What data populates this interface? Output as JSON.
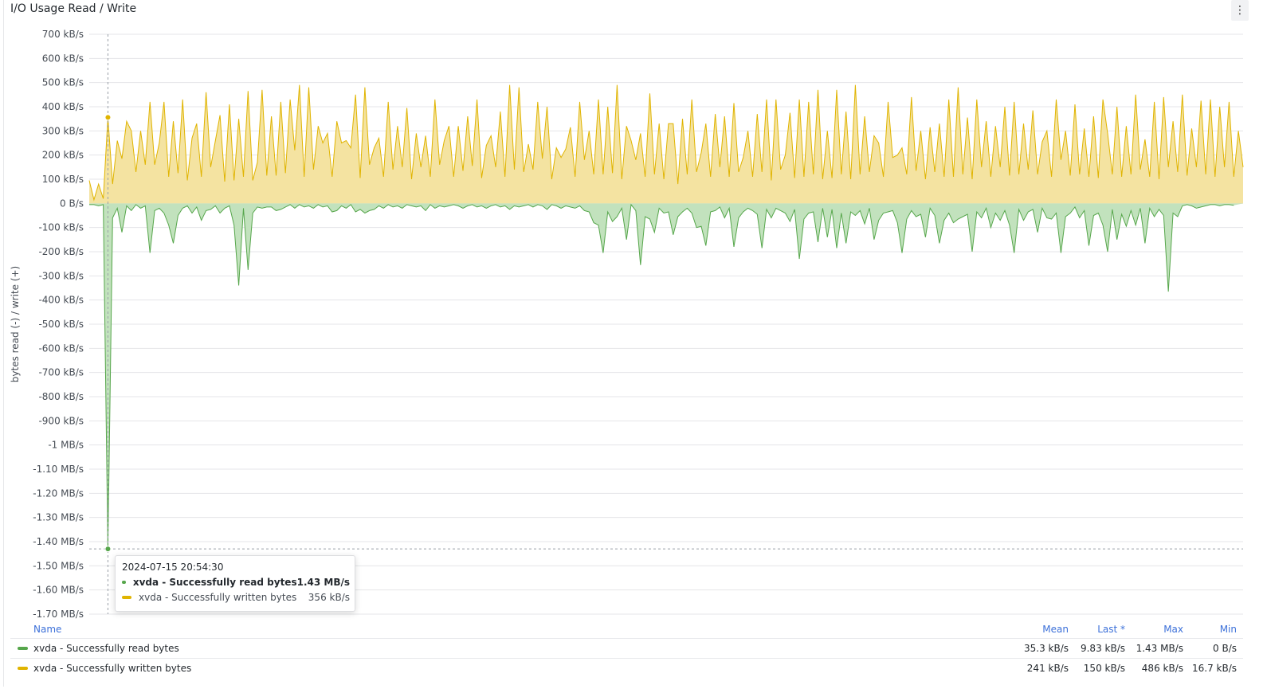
{
  "panel": {
    "title": "I/O Usage Read / Write",
    "menu_icon": "kebab-menu-icon",
    "menu_glyph": "⋮"
  },
  "colors": {
    "read": "#56a64b",
    "write": "#e0b400",
    "read_fill": "#c2e2bd",
    "write_fill": "#f4e3a1",
    "grid": "#e4e5e8"
  },
  "chart_data": {
    "type": "area",
    "ylabel": "bytes read (-) / write (+)",
    "y_unit": "kB/s",
    "ylim": [
      -1700,
      700
    ],
    "yticks": [
      700,
      600,
      500,
      400,
      300,
      200,
      100,
      0,
      -100,
      -200,
      -300,
      -400,
      -500,
      -600,
      -700,
      -800,
      -900,
      -1000,
      -1100,
      -1200,
      -1300,
      -1400,
      -1500,
      -1600,
      -1700
    ],
    "ytick_labels": [
      "700 kB/s",
      "600 kB/s",
      "500 kB/s",
      "400 kB/s",
      "300 kB/s",
      "200 kB/s",
      "100 kB/s",
      "0 B/s",
      "-100 kB/s",
      "-200 kB/s",
      "-300 kB/s",
      "-400 kB/s",
      "-500 kB/s",
      "-600 kB/s",
      "-700 kB/s",
      "-800 kB/s",
      "-900 kB/s",
      "-1 MB/s",
      "-1.10 MB/s",
      "-1.20 MB/s",
      "-1.30 MB/s",
      "-1.40 MB/s",
      "-1.50 MB/s",
      "-1.60 MB/s",
      "-1.70 MB/s"
    ],
    "grid": true,
    "series": [
      {
        "name": "xvda - Successfully written bytes",
        "sign": "+",
        "values": [
          95,
          15,
          80,
          20,
          356,
          80,
          260,
          185,
          340,
          300,
          130,
          300,
          160,
          420,
          160,
          250,
          420,
          110,
          340,
          125,
          430,
          95,
          270,
          330,
          110,
          460,
          150,
          260,
          365,
          90,
          410,
          95,
          350,
          110,
          465,
          95,
          170,
          470,
          115,
          360,
          115,
          420,
          125,
          430,
          220,
          490,
          110,
          480,
          140,
          320,
          250,
          290,
          110,
          340,
          250,
          260,
          230,
          450,
          105,
          480,
          160,
          230,
          270,
          110,
          420,
          140,
          320,
          150,
          395,
          100,
          290,
          150,
          280,
          110,
          430,
          160,
          260,
          320,
          110,
          320,
          135,
          360,
          155,
          430,
          105,
          240,
          280,
          150,
          380,
          110,
          490,
          140,
          480,
          130,
          245,
          140,
          420,
          185,
          400,
          100,
          230,
          190,
          225,
          315,
          110,
          420,
          180,
          300,
          120,
          430,
          120,
          400,
          125,
          490,
          100,
          320,
          260,
          180,
          290,
          110,
          455,
          120,
          330,
          100,
          330,
          330,
          80,
          350,
          120,
          430,
          130,
          210,
          330,
          110,
          370,
          150,
          360,
          110,
          415,
          130,
          190,
          300,
          110,
          370,
          130,
          430,
          95,
          430,
          140,
          200,
          375,
          105,
          430,
          110,
          420,
          120,
          470,
          100,
          300,
          105,
          470,
          120,
          380,
          100,
          490,
          120,
          360,
          130,
          280,
          250,
          110,
          420,
          190,
          200,
          230,
          120,
          440,
          135,
          300,
          100,
          315,
          130,
          330,
          110,
          430,
          110,
          480,
          120,
          355,
          100,
          430,
          150,
          340,
          110,
          320,
          150,
          400,
          115,
          420,
          120,
          330,
          140,
          385,
          120,
          255,
          300,
          110,
          430,
          180,
          300,
          115,
          410,
          120,
          310,
          110,
          360,
          105,
          430,
          290,
          120,
          400,
          110,
          320,
          120,
          450,
          140,
          265,
          110,
          420,
          100,
          440,
          150,
          340,
          130,
          450,
          115,
          310,
          150,
          425,
          120,
          430,
          110,
          400,
          150,
          420,
          110,
          300,
          150
        ]
      },
      {
        "name": "xvda - Successfully read bytes",
        "sign": "-",
        "values": [
          5,
          5,
          10,
          5,
          1430,
          60,
          20,
          120,
          10,
          30,
          5,
          20,
          10,
          205,
          30,
          20,
          40,
          90,
          165,
          50,
          20,
          10,
          40,
          15,
          70,
          30,
          25,
          10,
          40,
          20,
          10,
          90,
          340,
          20,
          275,
          40,
          15,
          20,
          15,
          15,
          30,
          25,
          15,
          5,
          20,
          5,
          15,
          10,
          20,
          5,
          15,
          10,
          35,
          30,
          10,
          20,
          5,
          35,
          25,
          40,
          30,
          25,
          10,
          20,
          5,
          15,
          10,
          20,
          5,
          10,
          15,
          10,
          30,
          5,
          20,
          10,
          15,
          10,
          5,
          10,
          20,
          10,
          5,
          15,
          10,
          20,
          10,
          5,
          15,
          10,
          25,
          10,
          15,
          10,
          5,
          15,
          5,
          10,
          25,
          5,
          10,
          20,
          10,
          15,
          20,
          10,
          30,
          35,
          80,
          90,
          205,
          35,
          75,
          55,
          20,
          150,
          5,
          30,
          255,
          55,
          65,
          120,
          20,
          40,
          35,
          130,
          55,
          35,
          20,
          40,
          100,
          95,
          175,
          35,
          30,
          15,
          60,
          20,
          180,
          60,
          35,
          20,
          30,
          45,
          185,
          25,
          60,
          20,
          30,
          40,
          75,
          25,
          230,
          65,
          40,
          35,
          160,
          20,
          140,
          25,
          185,
          40,
          165,
          35,
          50,
          30,
          85,
          20,
          150,
          70,
          40,
          35,
          30,
          80,
          205,
          65,
          30,
          55,
          45,
          140,
          20,
          50,
          165,
          70,
          40,
          80,
          65,
          55,
          45,
          200,
          35,
          60,
          20,
          100,
          40,
          70,
          30,
          90,
          205,
          25,
          70,
          35,
          25,
          120,
          20,
          60,
          65,
          40,
          205,
          55,
          40,
          15,
          60,
          30,
          175,
          50,
          40,
          90,
          200,
          25,
          150,
          45,
          95,
          30,
          90,
          20,
          165,
          20,
          55,
          25,
          50,
          365,
          40,
          55,
          10,
          5,
          10,
          20,
          15,
          10,
          5,
          5,
          10,
          5,
          5,
          8
        ]
      }
    ]
  },
  "tooltip": {
    "time": "2024-07-15 20:54:30",
    "rows": [
      {
        "name": "xvda - Successfully read bytes",
        "value": "1.43 MB/s"
      },
      {
        "name": "xvda - Successfully written bytes",
        "value": "356 kB/s"
      }
    ]
  },
  "legend": {
    "headers": {
      "name": "Name",
      "mean": "Mean",
      "last": "Last *",
      "max": "Max",
      "min": "Min"
    },
    "rows": [
      {
        "name": "xvda - Successfully read bytes",
        "mean": "35.3 kB/s",
        "last": "9.83 kB/s",
        "max": "1.43 MB/s",
        "min": "0 B/s"
      },
      {
        "name": "xvda - Successfully written bytes",
        "mean": "241 kB/s",
        "last": "150 kB/s",
        "max": "486 kB/s",
        "min": "16.7 kB/s"
      }
    ]
  }
}
